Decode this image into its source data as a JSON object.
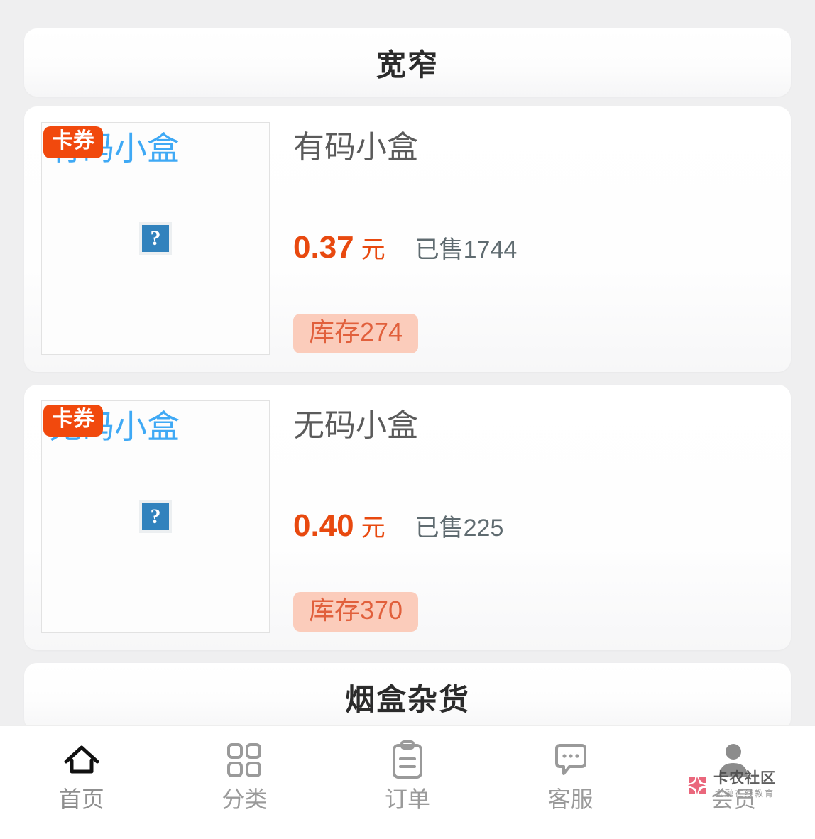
{
  "page": {
    "background_color": "#efeff0",
    "accent_color": "#e8490f",
    "badge_color": "#f1490d"
  },
  "sections": [
    {
      "title": "宽窄"
    }
  ],
  "section_next": {
    "title": "烟盒杂货"
  },
  "products": [
    {
      "badge": "卡券",
      "image_alt": "有码小盒",
      "image_glyph": "?",
      "name": "有码小盒",
      "price": "0.37",
      "price_unit": "元",
      "sold": "已售1744",
      "stock": "库存274"
    },
    {
      "badge": "卡券",
      "image_alt": "无码小盒",
      "image_glyph": "?",
      "name": "无码小盒",
      "price": "0.40",
      "price_unit": "元",
      "sold": "已售225",
      "stock": "库存370"
    }
  ],
  "tabbar": {
    "items": [
      {
        "icon": "home-icon",
        "label": "首页",
        "active": true
      },
      {
        "icon": "grid-icon",
        "label": "分类",
        "active": false
      },
      {
        "icon": "clipboard-icon",
        "label": "订单",
        "active": false
      },
      {
        "icon": "chat-icon",
        "label": "客服",
        "active": false
      },
      {
        "icon": "person-icon",
        "label": "会员",
        "active": false
      }
    ]
  },
  "watermark": {
    "brand": "卡农社区",
    "subtitle": "金融在线教育",
    "logo_color": "#e8536b"
  }
}
